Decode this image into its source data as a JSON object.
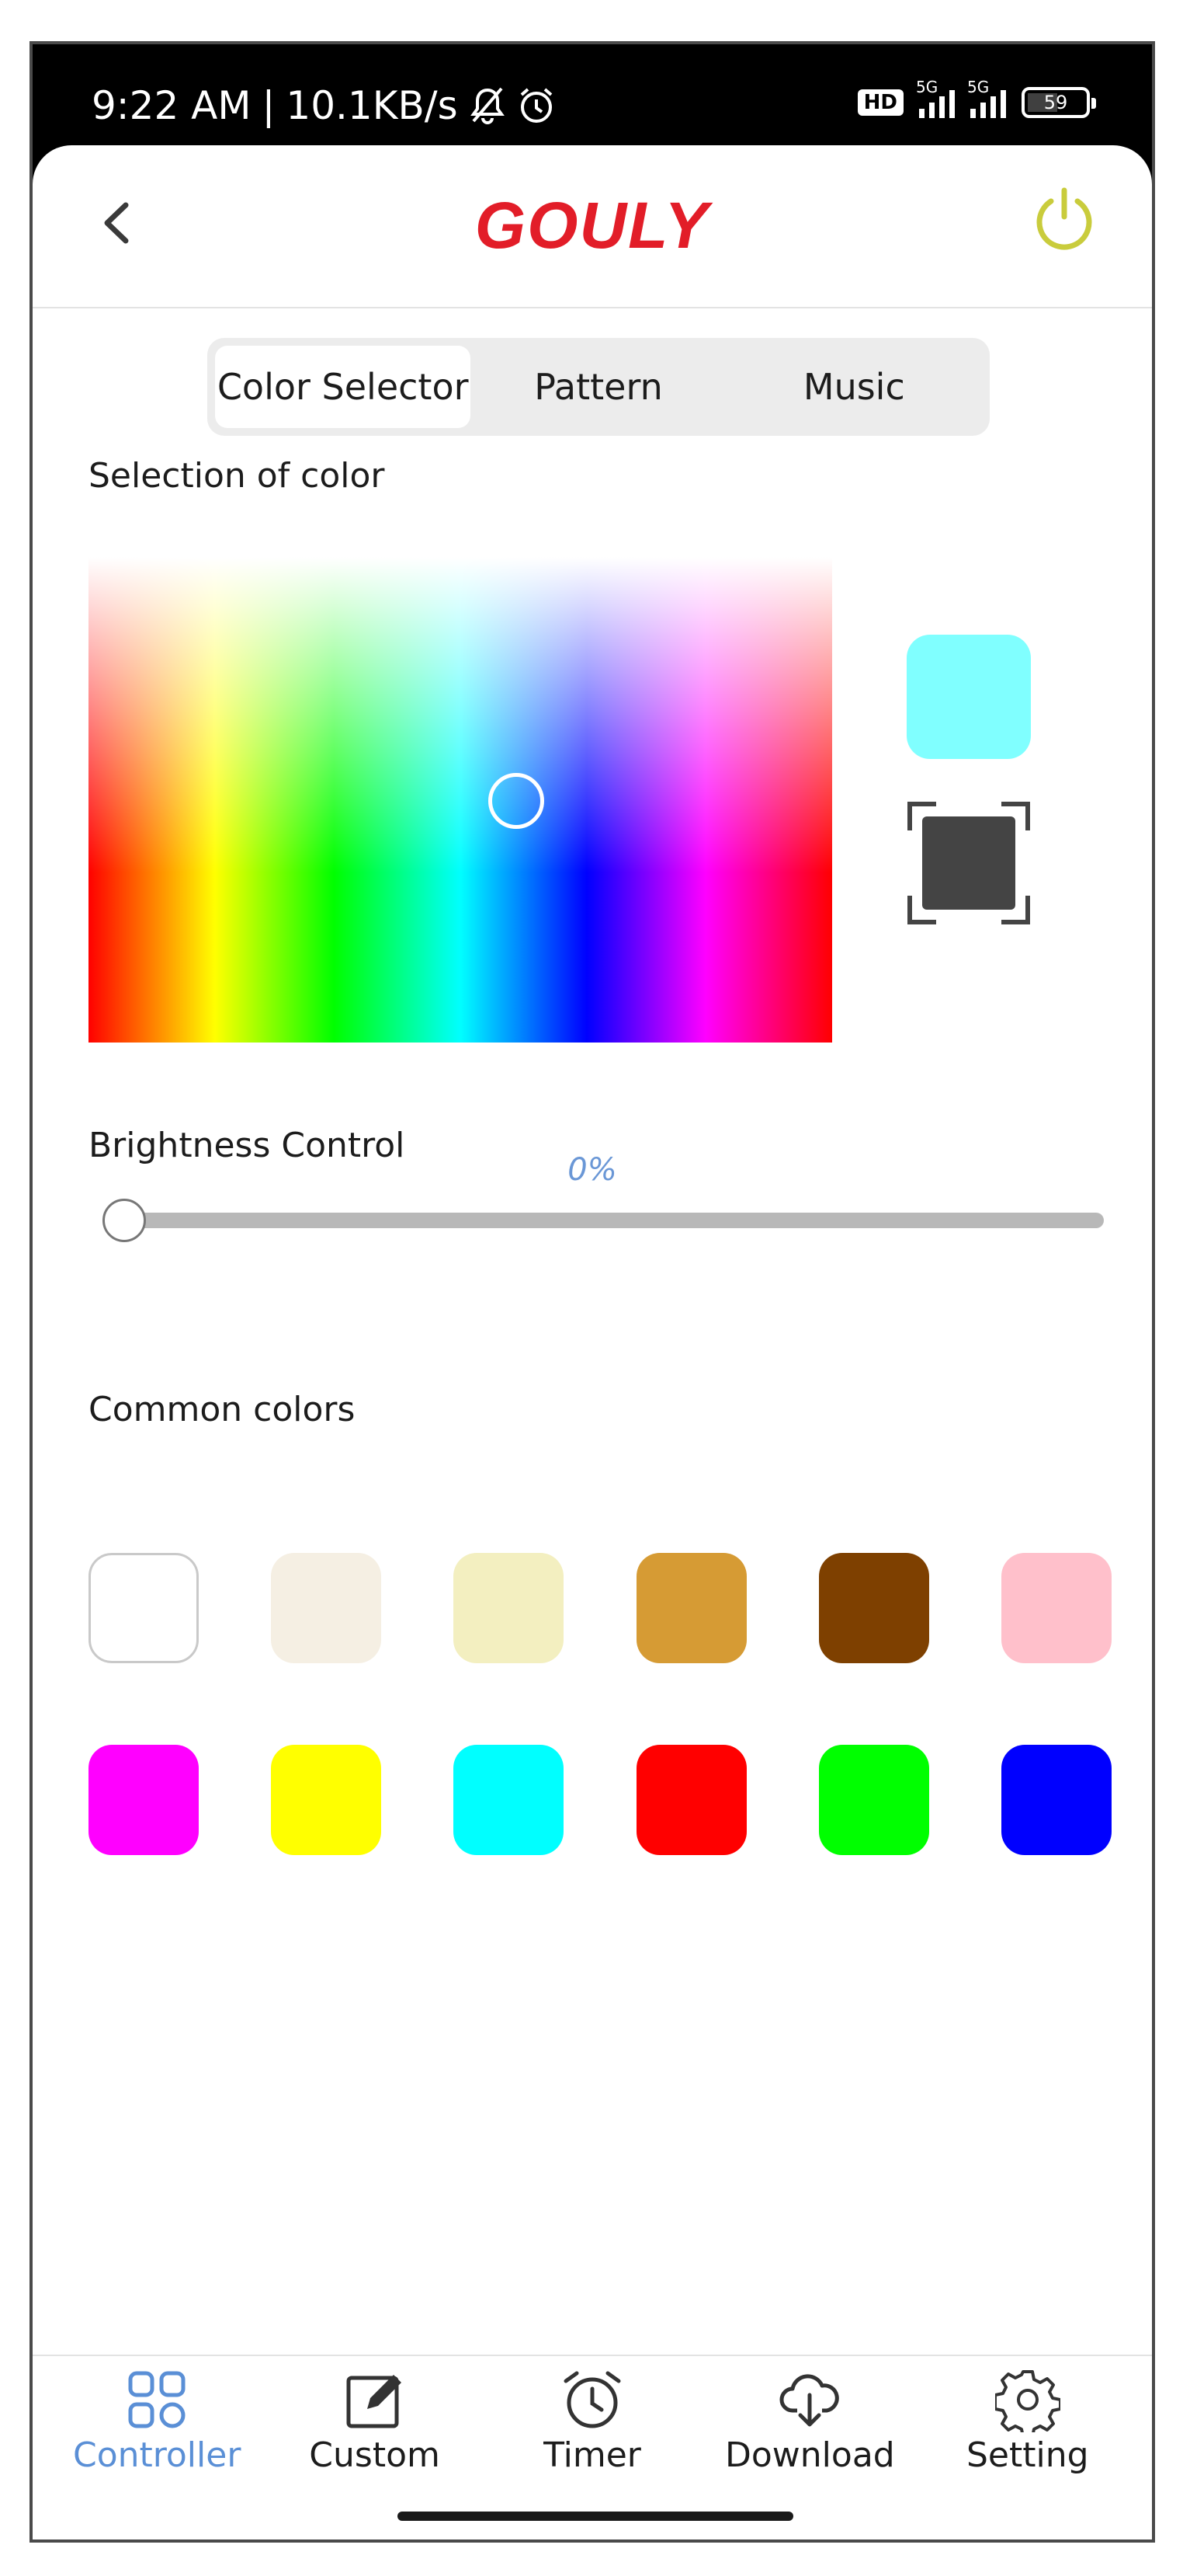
{
  "status_bar": {
    "time": "9:22 AM",
    "separator": "|",
    "network_speed": "10.1KB/s",
    "hd_badge": "HD",
    "signal_1_tag": "5G",
    "signal_2_tag": "5G",
    "battery_level": "59"
  },
  "header": {
    "brand": "GOULY"
  },
  "tabs": [
    {
      "label": "Color Selector",
      "active": true
    },
    {
      "label": "Pattern",
      "active": false
    },
    {
      "label": "Music",
      "active": false
    }
  ],
  "color_section": {
    "title": "Selection of color",
    "selected_color": "#80ffff"
  },
  "brightness_section": {
    "title": "Brightness Control",
    "value": "0%",
    "level": 0
  },
  "common_colors": {
    "title": "Common colors",
    "rows": [
      [
        "#ffffff",
        "#f5efe3",
        "#f3efc0",
        "#d69b34",
        "#7e4000",
        "#ffc0cb"
      ],
      [
        "#ff00ff",
        "#ffff00",
        "#00ffff",
        "#ff0000",
        "#00ff00",
        "#0000ff"
      ]
    ]
  },
  "bottom_nav": [
    {
      "label": "Controller",
      "icon": "grid-icon",
      "active": true
    },
    {
      "label": "Custom",
      "icon": "edit-icon",
      "active": false
    },
    {
      "label": "Timer",
      "icon": "alarm-clock-icon",
      "active": false
    },
    {
      "label": "Download",
      "icon": "cloud-download-icon",
      "active": false
    },
    {
      "label": "Setting",
      "icon": "gear-icon",
      "active": false
    }
  ],
  "colors": {
    "brand_red": "#e21d28",
    "power_yellow": "#c9cc3c",
    "accent_blue": "#5a8fd6",
    "scan_square": "#444444"
  }
}
